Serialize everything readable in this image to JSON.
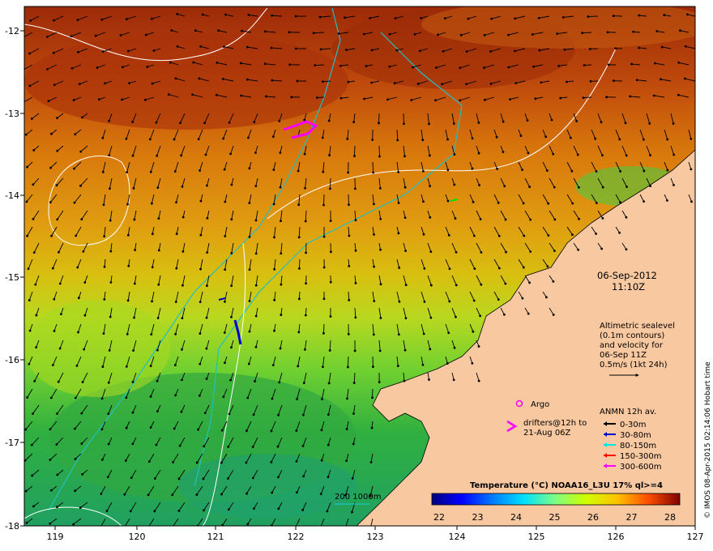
{
  "map": {
    "date": "06-Sep-2012",
    "time": "11:10Z",
    "lon_ticks": [
      "119",
      "120",
      "121",
      "122",
      "123",
      "124",
      "125",
      "126",
      "127"
    ],
    "lat_ticks": [
      "-12",
      "-13",
      "-14",
      "-15",
      "-16",
      "-17",
      "-18"
    ],
    "altimetry_lines": [
      "Altimetric sealevel",
      "(0.1m contours)",
      "and velocity for",
      "06-Sep 11Z",
      "0.5m/s (1kt 24h)"
    ],
    "argo_label": "Argo",
    "drifters_lines": [
      "drifters@12h to",
      "21-Aug 06Z"
    ],
    "anmn_title": "ANMN 12h av.",
    "anmn_items": [
      {
        "label": "0-30m",
        "color": "#000000"
      },
      {
        "label": "30-80m",
        "color": "#0000cc"
      },
      {
        "label": "80-150m",
        "color": "#00e5e5"
      },
      {
        "label": "150-300m",
        "color": "#ff0000"
      },
      {
        "label": "300-600m",
        "color": "#ff00ff"
      }
    ],
    "colorbar_title": "Temperature (°C) NOAA16_L3U 17% ql>=4",
    "colorbar_ticks": [
      "22",
      "23",
      "24",
      "25",
      "26",
      "27",
      "28"
    ],
    "bathy_label": "200  1000m",
    "credit": "© IMOS 08-Apr-2015 02:14:06 Hobart time"
  }
}
